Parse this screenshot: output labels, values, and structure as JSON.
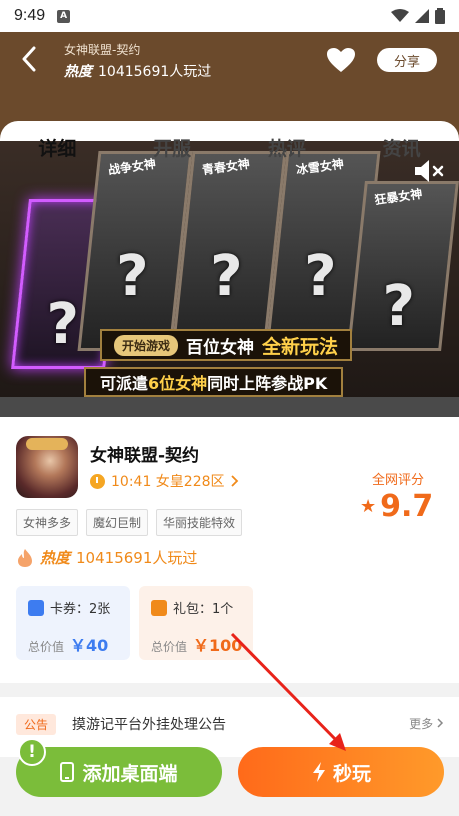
{
  "status_bar": {
    "time": "9:49",
    "badge": "A"
  },
  "header": {
    "game_name": "女神联盟-契约",
    "heat_label": "热度",
    "heat_text": "10415691人玩过",
    "share_label": "分享"
  },
  "tabs": [
    {
      "label": "详细",
      "active": true
    },
    {
      "label": "开服",
      "active": false
    },
    {
      "label": "热评",
      "active": false
    },
    {
      "label": "资讯",
      "active": false
    }
  ],
  "banner": {
    "cards": [
      "战争女神",
      "青春女神",
      "冰雪女神",
      "狂暴女神"
    ],
    "pill": "开始游戏",
    "slogan_part1": "百位女神",
    "slogan_part2": "全新玩法",
    "slogan2_a": "可派遣",
    "slogan2_b": "6位女神",
    "slogan2_c": "同时上阵参战PK",
    "mute_icon": "speaker-mute-icon"
  },
  "game": {
    "title": "女神联盟-契约",
    "server": "10:41 女皇228区",
    "tags": [
      "女神多多",
      "魔幻巨制",
      "华丽技能特效"
    ],
    "rating_label": "全网评分",
    "rating": "9.7",
    "heat_label": "热度",
    "heat_text": "10415691人玩过"
  },
  "perks": {
    "coupon_label": "卡券：2张",
    "coupon_total_label": "总价值",
    "coupon_total": "￥40",
    "gift_label": "礼包：1个",
    "gift_total_label": "总价值",
    "gift_total": "￥100"
  },
  "notice": {
    "badge": "公告",
    "text": "摸游记平台外挂处理公告",
    "more": "更多"
  },
  "actions": {
    "desktop_label": "添加桌面端",
    "play_label": "秒玩",
    "alert": "!"
  },
  "colors": {
    "header_brown": "#6b4a2c",
    "accent_orange": "#f06a1a",
    "green": "#7bbd3a",
    "blue": "#3d7cf0"
  }
}
